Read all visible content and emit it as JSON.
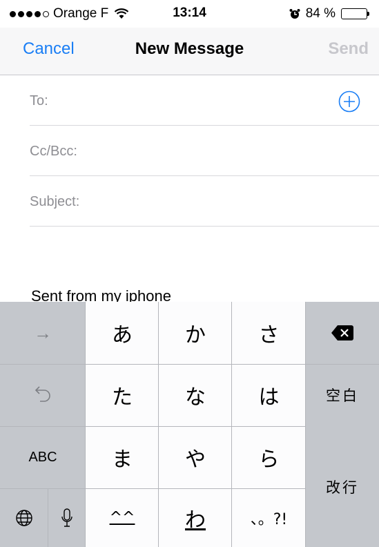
{
  "status_bar": {
    "carrier": "Orange F",
    "time": "13:14",
    "battery_percent": "84 %",
    "battery_level": 0.84
  },
  "nav": {
    "cancel": "Cancel",
    "title": "New Message",
    "send": "Send"
  },
  "fields": {
    "to": "To:",
    "cc_bcc": "Cc/Bcc:",
    "subject": "Subject:"
  },
  "body": {
    "signature": "Sent from my iphone"
  },
  "keyboard": {
    "row1": [
      "あ",
      "か",
      "さ"
    ],
    "row2": [
      "た",
      "な",
      "は"
    ],
    "row3": [
      "ま",
      "や",
      "ら"
    ],
    "row4": [
      "^^",
      "わ",
      "、。?!"
    ],
    "space": "空白",
    "return": "改行",
    "abc": "ABC",
    "forward_arrow": "→"
  },
  "colors": {
    "accent": "#1a7ef5",
    "disabled": "#c7c7cc",
    "keyboard_bg": "#c4c7cc"
  }
}
